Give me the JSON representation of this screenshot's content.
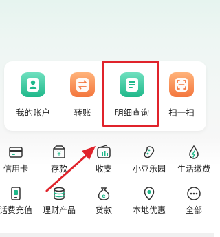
{
  "main_functions": [
    {
      "label": "我的账户",
      "icon": "account-icon",
      "color": "green"
    },
    {
      "label": "转账",
      "icon": "transfer-icon",
      "color": "orange"
    },
    {
      "label": "明细查询",
      "icon": "details-icon",
      "color": "green"
    },
    {
      "label": "扫一扫",
      "icon": "scan-icon",
      "color": "orange"
    }
  ],
  "services": [
    {
      "label": "信用卡",
      "icon": "credit-card-icon"
    },
    {
      "label": "存款",
      "icon": "deposit-icon"
    },
    {
      "label": "收支",
      "icon": "income-expense-icon"
    },
    {
      "label": "小豆乐园",
      "icon": "bean-park-icon"
    },
    {
      "label": "生活缴费",
      "icon": "utility-payment-icon"
    },
    {
      "label": "话费充值",
      "icon": "phone-recharge-icon"
    },
    {
      "label": "理财产品",
      "icon": "wealth-product-icon"
    },
    {
      "label": "贷款",
      "icon": "loan-icon"
    },
    {
      "label": "本地优惠",
      "icon": "local-deals-icon"
    },
    {
      "label": "全部",
      "icon": "all-icon"
    }
  ],
  "colors": {
    "green_accent": "#1fb88a",
    "orange_accent": "#f3763d",
    "highlight_red": "#e0232b"
  }
}
